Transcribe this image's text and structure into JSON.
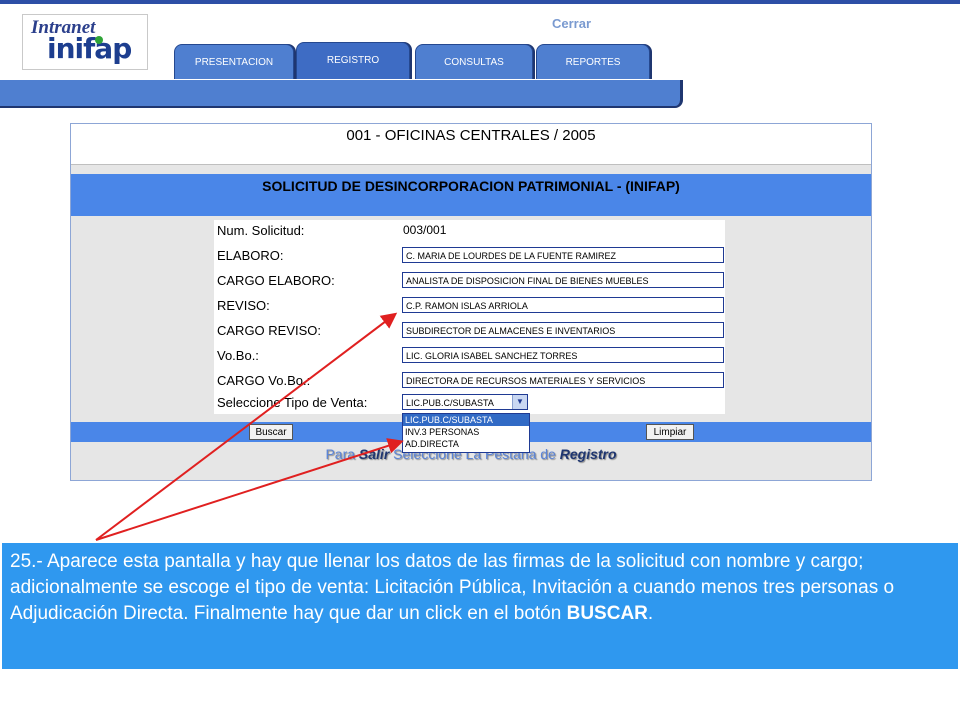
{
  "header": {
    "logo_top": "Intranet",
    "logo_bottom": "inifap",
    "close_link": "Cerrar"
  },
  "tabs": [
    {
      "label": "PRESENTACION",
      "active": false
    },
    {
      "label": "REGISTRO",
      "active": true
    },
    {
      "label": "CONSULTAS",
      "active": false
    },
    {
      "label": "REPORTES",
      "active": false
    }
  ],
  "panel": {
    "office_title": "001 - OFICINAS CENTRALES / 2005",
    "form_title": "SOLICITUD DE DESINCORPORACION PATRIMONIAL - (INIFAP)",
    "fields": [
      {
        "label": "Num. Solicitud:",
        "value": "003/001"
      },
      {
        "label": "ELABORO:",
        "value": "C. MARIA DE LOURDES DE LA FUENTE RAMIREZ"
      },
      {
        "label": "CARGO ELABORO:",
        "value": "ANALISTA DE DISPOSICION FINAL DE BIENES MUEBLES"
      },
      {
        "label": "REVISO:",
        "value": "C.P. RAMON ISLAS ARRIOLA"
      },
      {
        "label": "CARGO REVISO:",
        "value": "SUBDIRECTOR DE ALMACENES E INVENTARIOS"
      },
      {
        "label": "Vo.Bo.:",
        "value": "LIC. GLORIA ISABEL SANCHEZ TORRES"
      },
      {
        "label": "CARGO Vo.Bo.:",
        "value": "DIRECTORA DE RECURSOS MATERIALES Y SERVICIOS"
      },
      {
        "label": "Seleccione Tipo de Venta:",
        "value": "LIC.PUB.C/SUBASTA"
      }
    ],
    "sale_options": [
      "LIC.PUB.C/SUBASTA",
      "INV.3 PERSONAS",
      "AD.DIRECTA"
    ],
    "search_button": "Buscar",
    "clear_button": "Limpiar",
    "hint_prefix": "Para ",
    "hint_exit": "Salir",
    "hint_middle": " Seleccione La Pestaña de ",
    "hint_tab": "Registro"
  },
  "caption": {
    "text": "25.- Aparece esta pantalla y hay que llenar los datos de las firmas de la solicitud con nombre y cargo; adicionalmente se escoge el tipo de venta: Licitación Pública, Invitación a cuando menos tres personas o Adjudicación Directa. Finalmente hay que dar un click en el botón ",
    "bold": "BUSCAR",
    "end": "."
  },
  "colors": {
    "accent": "#4a86e8",
    "caption_bg": "#2f98ef",
    "arrow": "#e02020"
  }
}
